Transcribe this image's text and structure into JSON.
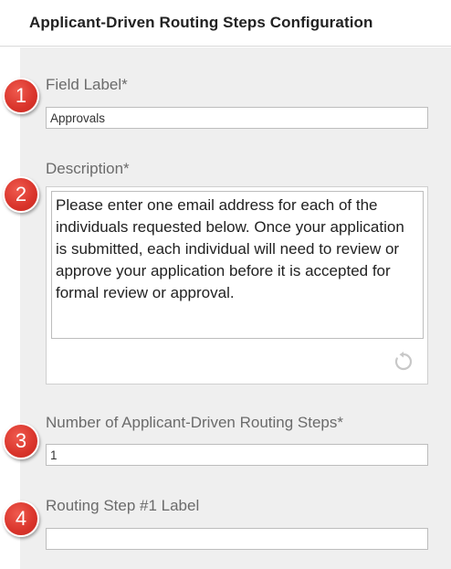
{
  "header": {
    "title": "Applicant-Driven Routing Steps Configuration"
  },
  "fields": {
    "field_label": {
      "badge": "1",
      "label": "Field Label*",
      "value": "Approvals"
    },
    "description": {
      "badge": "2",
      "label": "Description*",
      "value": "Please enter one email address for each of the individuals requested below. Once your application is submitted, each individual will need to review or approve your application before it is accepted for formal review or approval."
    },
    "num_steps": {
      "badge": "3",
      "label": "Number of Applicant-Driven Routing Steps*",
      "value": "1"
    },
    "step1_label": {
      "badge": "4",
      "label": "Routing Step #1 Label",
      "value": ""
    }
  },
  "icons": {
    "reset": "reset-icon"
  },
  "colors": {
    "badge": "#d9342b",
    "panel": "#efefef"
  }
}
